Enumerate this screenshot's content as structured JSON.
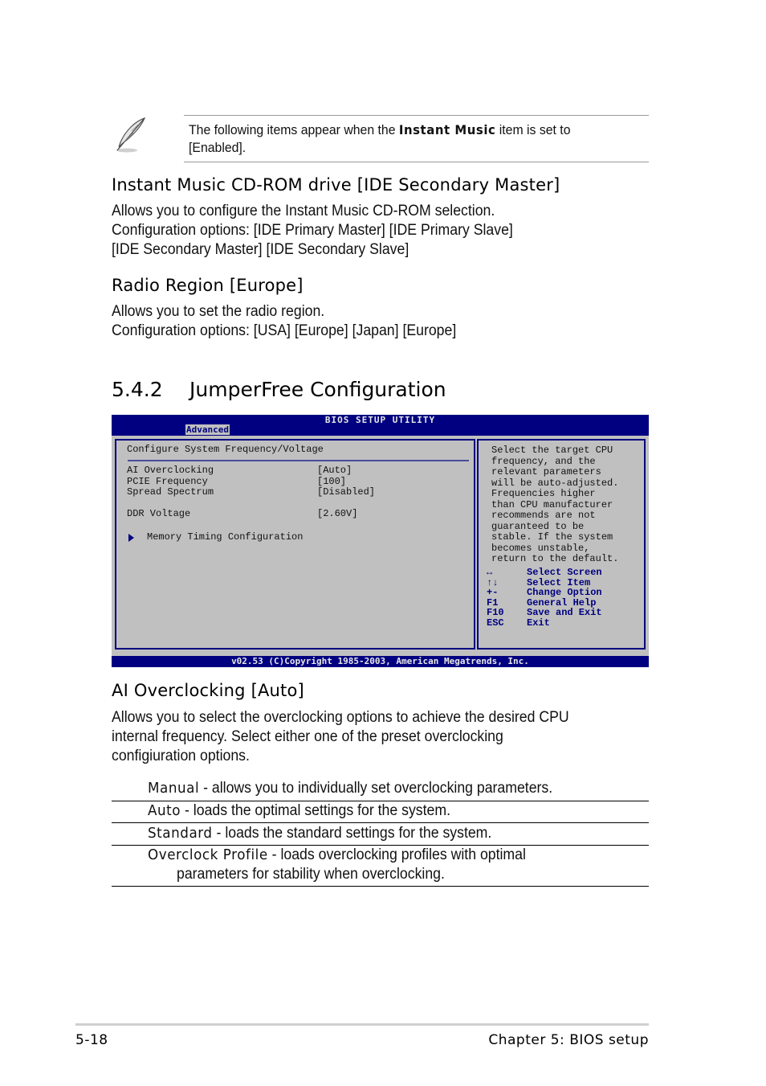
{
  "note": {
    "icon": "feather-pen-icon",
    "text_before": "The following items appear when the ",
    "bold": "Instant Music",
    "text_after": " item is set to",
    "line2": "[Enabled]."
  },
  "instant_music_cdrom": {
    "heading": "Instant Music CD-ROM drive [IDE Secondary Master]",
    "lines": [
      "Allows you to configure the Instant Music CD-ROM selection.",
      "Configuration options: [IDE Primary Master] [IDE Primary Slave]",
      "[IDE Secondary Master] [IDE Secondary Slave]"
    ]
  },
  "radio_region": {
    "heading": "Radio Region [Europe]",
    "lines": [
      "Allows you to set the radio region.",
      "Configuration options: [USA] [Europe] [Japan] [Europe]"
    ]
  },
  "section": {
    "number": "5.4.2",
    "title": "JumperFree Configuration"
  },
  "bios": {
    "title": "BIOS SETUP UTILITY",
    "active_tab": "Advanced",
    "panel_title": "Configure System Frequency/Voltage",
    "items": [
      {
        "label": "AI Overclocking",
        "value": "[Auto]"
      },
      {
        "label": "PCIE Frequency",
        "value": "[100]"
      },
      {
        "label": "Spread Spectrum",
        "value": "[Disabled]"
      },
      {
        "label": "DDR Voltage",
        "value": "[2.60V]"
      }
    ],
    "submenu": "Memory Timing Configuration",
    "help_lines": [
      "Select the target CPU",
      "frequency, and the",
      "relevant parameters",
      "will be auto-adjusted.",
      "Frequencies higher",
      "than CPU manufacturer",
      "recommends are not",
      "guaranteed to be",
      "stable. If the system",
      "becomes unstable,",
      "return to the default."
    ],
    "keys": [
      {
        "key": "↔",
        "action": "Select Screen"
      },
      {
        "key": "↑↓",
        "action": "Select Item"
      },
      {
        "key": "+-",
        "action": "Change Option"
      },
      {
        "key": "F1",
        "action": "General Help"
      },
      {
        "key": "F10",
        "action": "Save and Exit"
      },
      {
        "key": "ESC",
        "action": "Exit"
      }
    ],
    "footer": "v02.53 (C)Copyright 1985-2003, American Megatrends, Inc."
  },
  "ai_overclocking": {
    "heading": "AI Overclocking [Auto]",
    "lines": [
      "Allows you to select the overclocking options to achieve the desired CPU",
      "internal frequency. Select either one of the preset overclocking",
      "configiuration options."
    ],
    "options": [
      {
        "name": "Manual",
        "desc": " - allows you to individually set overclocking parameters."
      },
      {
        "name": "Auto",
        "desc": " - loads the optimal settings for the system."
      },
      {
        "name": "Standard",
        "desc": " - loads the standard settings for the system."
      },
      {
        "name": "Overclock Profile",
        "desc": " - loads overclocking profiles with optimal",
        "desc2": "parameters for stability when overclocking."
      }
    ]
  },
  "footer": {
    "page": "5-18",
    "chapter": "Chapter 5: BIOS setup"
  }
}
